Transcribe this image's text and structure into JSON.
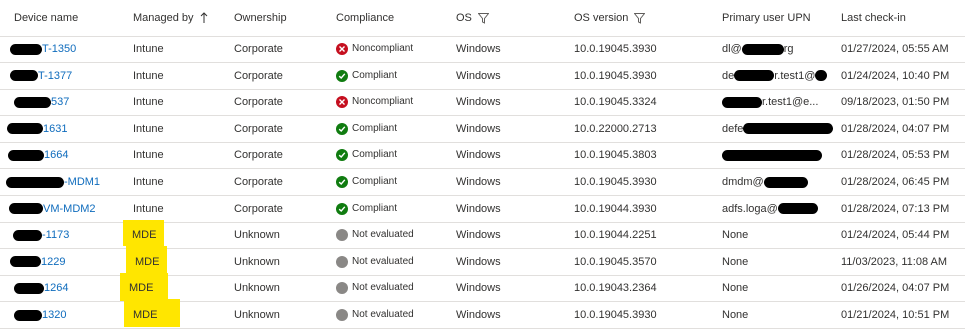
{
  "columns": {
    "device_name": "Device name",
    "managed_by": "Managed by",
    "ownership": "Ownership",
    "compliance": "Compliance",
    "os": "OS",
    "os_version": "OS version",
    "primary_user_upn": "Primary user UPN",
    "last_check_in": "Last check-in"
  },
  "rows": [
    {
      "name_suffix": "T-1350",
      "managed_by": "Intune",
      "ownership": "Corporate",
      "compliance": "Noncompliant",
      "compliance_state": "bad",
      "os": "Windows",
      "os_version": "10.0.19045.3930",
      "upn_prefix": "dl@",
      "upn_suffix": "rg",
      "last_check_in": "01/27/2024, 05:55 AM"
    },
    {
      "name_suffix": "T-1377",
      "managed_by": "Intune",
      "ownership": "Corporate",
      "compliance": "Compliant",
      "compliance_state": "ok",
      "os": "Windows",
      "os_version": "10.0.19045.3930",
      "upn_prefix": "de",
      "upn_suffix": "r.test1@",
      "last_check_in": "01/24/2024, 10:40 PM"
    },
    {
      "name_suffix": "537",
      "managed_by": "Intune",
      "ownership": "Corporate",
      "compliance": "Noncompliant",
      "compliance_state": "bad",
      "os": "Windows",
      "os_version": "10.0.19045.3324",
      "upn_prefix": "",
      "upn_suffix": "r.test1@e...",
      "last_check_in": "09/18/2023, 01:50 PM"
    },
    {
      "name_suffix": "1631",
      "managed_by": "Intune",
      "ownership": "Corporate",
      "compliance": "Compliant",
      "compliance_state": "ok",
      "os": "Windows",
      "os_version": "10.0.22000.2713",
      "upn_prefix": "defe",
      "upn_suffix": "",
      "last_check_in": "01/28/2024, 04:07 PM"
    },
    {
      "name_suffix": "1664",
      "managed_by": "Intune",
      "ownership": "Corporate",
      "compliance": "Compliant",
      "compliance_state": "ok",
      "os": "Windows",
      "os_version": "10.0.19045.3803",
      "upn_prefix": "",
      "upn_suffix": "",
      "last_check_in": "01/28/2024, 05:53 PM"
    },
    {
      "name_suffix": "-MDM1",
      "managed_by": "Intune",
      "ownership": "Corporate",
      "compliance": "Compliant",
      "compliance_state": "ok",
      "os": "Windows",
      "os_version": "10.0.19045.3930",
      "upn_prefix": "dmdm@",
      "upn_suffix": "",
      "last_check_in": "01/28/2024, 06:45 PM"
    },
    {
      "name_suffix": "VM-MDM2",
      "managed_by": "Intune",
      "ownership": "Corporate",
      "compliance": "Compliant",
      "compliance_state": "ok",
      "os": "Windows",
      "os_version": "10.0.19044.3930",
      "upn_prefix": "adfs.loga@",
      "upn_suffix": "",
      "last_check_in": "01/28/2024, 07:13 PM"
    },
    {
      "name_suffix": "-1173",
      "managed_by": "MDE",
      "ownership": "Unknown",
      "compliance": "Not evaluated",
      "compliance_state": "none",
      "os": "Windows",
      "os_version": "10.0.19044.2251",
      "upn_prefix": "None",
      "upn_suffix": "",
      "last_check_in": "01/24/2024, 05:44 PM"
    },
    {
      "name_suffix": "1229",
      "managed_by": "MDE",
      "ownership": "Unknown",
      "compliance": "Not evaluated",
      "compliance_state": "none",
      "os": "Windows",
      "os_version": "10.0.19045.3570",
      "upn_prefix": "None",
      "upn_suffix": "",
      "last_check_in": "11/03/2023, 11:08 AM"
    },
    {
      "name_suffix": "1264",
      "managed_by": "MDE",
      "ownership": "Unknown",
      "compliance": "Not evaluated",
      "compliance_state": "none",
      "os": "Windows",
      "os_version": "10.0.19043.2364",
      "upn_prefix": "None",
      "upn_suffix": "",
      "last_check_in": "01/26/2024, 04:07 PM"
    },
    {
      "name_suffix": "1320",
      "managed_by": "MDE",
      "ownership": "Unknown",
      "compliance": "Not evaluated",
      "compliance_state": "none",
      "os": "Windows",
      "os_version": "10.0.19045.3930",
      "upn_prefix": "None",
      "upn_suffix": "",
      "last_check_in": "01/21/2024, 10:51 PM"
    }
  ],
  "colors": {
    "link": "#0f6cbd",
    "compliant": "#107c10",
    "noncompliant": "#c50f1f",
    "not_evaluated": "#8a8886",
    "highlight": "#ffe600"
  },
  "icons": {
    "sort": "arrow-up-icon",
    "filter": "filter-icon"
  }
}
